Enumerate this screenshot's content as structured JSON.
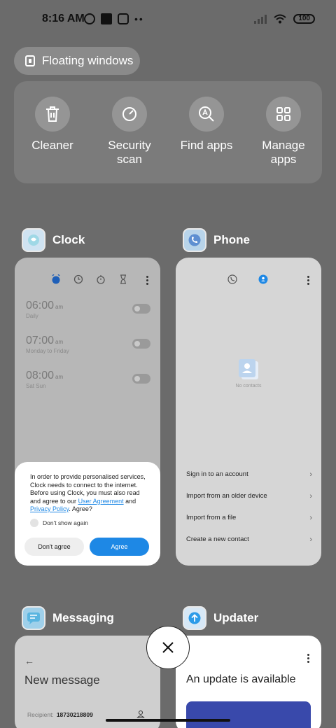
{
  "status_bar": {
    "time": "8:16 AM",
    "battery": "100"
  },
  "floating_windows": {
    "label": "Floating windows"
  },
  "quick_actions": [
    {
      "label": "Cleaner",
      "icon": "trash-icon"
    },
    {
      "label": "Security\nscan",
      "icon": "gauge-icon"
    },
    {
      "label": "Find apps",
      "icon": "search-a-icon"
    },
    {
      "label": "Manage\napps",
      "icon": "grid-icon"
    }
  ],
  "apps": {
    "clock": {
      "name": "Clock",
      "alarms": [
        {
          "time": "06:00",
          "suffix": "am",
          "days": "Daily"
        },
        {
          "time": "07:00",
          "suffix": "am",
          "days": "Monday to Friday"
        },
        {
          "time": "08:00",
          "suffix": "am",
          "days": "Sat Sun"
        }
      ],
      "dialog": {
        "message_pre": "In order to provide personalised services, Clock needs to connect to the internet. Before using Clock, you must also read and agree to our ",
        "link_user_agreement": "User Agreement",
        "and": " and ",
        "link_privacy": "Privacy Policy",
        "message_post": ". Agree?",
        "dont_show": "Don't show again",
        "disagree": "Don't agree",
        "agree": "Agree"
      }
    },
    "phone": {
      "name": "Phone",
      "no_contacts": "No contacts",
      "options": [
        "Sign in to an account",
        "Import from an older device",
        "Import from a file",
        "Create a new contact"
      ]
    },
    "messaging": {
      "name": "Messaging",
      "title": "New message",
      "recipient_label": "Recipient:",
      "recipient_value": "18730218809"
    },
    "updater": {
      "name": "Updater",
      "title": "An update is available"
    }
  },
  "colors": {
    "accent": "#1e88e5",
    "background": "#6b6b6b"
  }
}
